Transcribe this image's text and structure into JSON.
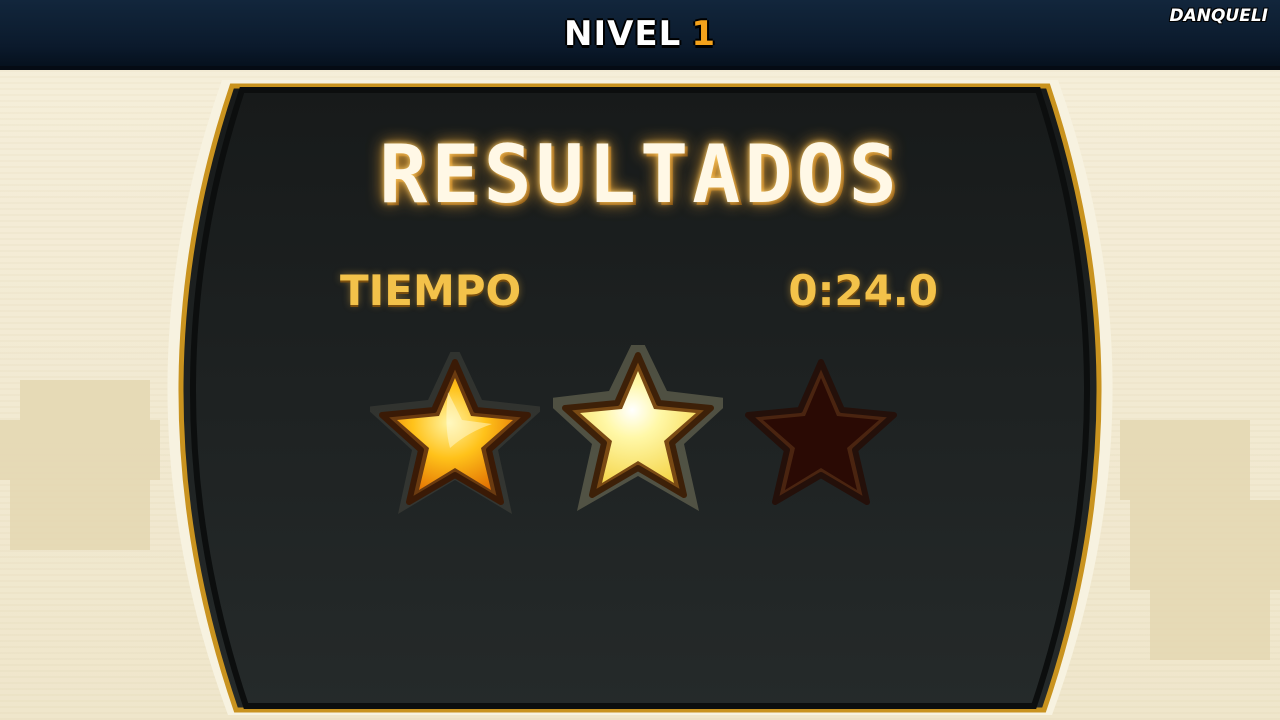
{
  "header": {
    "level_label": "NIVEL",
    "level_number": "1",
    "brand": "DANQUELI"
  },
  "results": {
    "title": "RESULTADOS",
    "time_label": "TIEMPO",
    "time_value": "0:24.0"
  },
  "stars": {
    "earned": 2,
    "total": 3
  },
  "colors": {
    "panel": "#1c2020",
    "panel_border": "#c9931f",
    "star_gold": "#ffc21a",
    "star_empty": "#2a0a04"
  }
}
